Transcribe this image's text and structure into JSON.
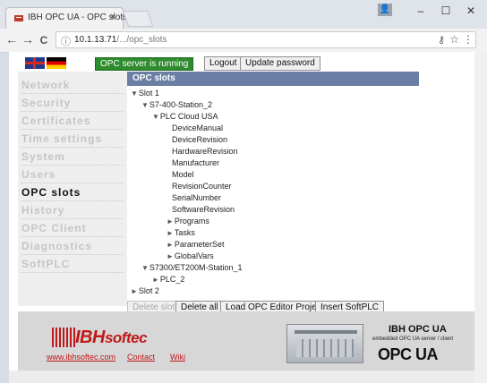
{
  "browser": {
    "tab_title": "IBH OPC UA - OPC slots",
    "tab_close": "×",
    "window_controls": {
      "minimize": "–",
      "maximize": "☐",
      "close": "✕"
    },
    "url_host": "10.1.13.71",
    "url_path": "/‌...‌/opc_slots",
    "nav": {
      "back": "←",
      "forward": "→",
      "reload": "C"
    }
  },
  "header": {
    "server_status": "OPC server is running",
    "logout_label": "Logout",
    "update_password_label": "Update password"
  },
  "sidebar": {
    "items": [
      {
        "label": "Network",
        "active": false
      },
      {
        "label": "Security",
        "active": false
      },
      {
        "label": "Certificates",
        "active": false
      },
      {
        "label": "Time settings",
        "active": false
      },
      {
        "label": "System",
        "active": false
      },
      {
        "label": "Users",
        "active": false
      },
      {
        "label": "OPC slots",
        "active": true
      },
      {
        "label": "History",
        "active": false
      },
      {
        "label": "OPC Client",
        "active": false
      },
      {
        "label": "Diagnostics",
        "active": false
      },
      {
        "label": "SoftPLC",
        "active": false
      }
    ]
  },
  "content": {
    "title": "OPC slots",
    "tree": [
      {
        "label": "Slot 1",
        "arrow": "▼",
        "level": 0
      },
      {
        "label": "S7-400-Station_2",
        "arrow": "▼",
        "level": 1
      },
      {
        "label": "PLC Cloud USA",
        "arrow": "▼",
        "level": 2
      },
      {
        "label": "DeviceManual",
        "arrow": "",
        "level": 3
      },
      {
        "label": "DeviceRevision",
        "arrow": "",
        "level": 3
      },
      {
        "label": "HardwareRevision",
        "arrow": "",
        "level": 3
      },
      {
        "label": "Manufacturer",
        "arrow": "",
        "level": 3
      },
      {
        "label": "Model",
        "arrow": "",
        "level": 3
      },
      {
        "label": "RevisionCounter",
        "arrow": "",
        "level": 3
      },
      {
        "label": "SerialNumber",
        "arrow": "",
        "level": 3
      },
      {
        "label": "SoftwareRevision",
        "arrow": "",
        "level": 3
      },
      {
        "label": "Programs",
        "arrow": "►",
        "level": 2.6
      },
      {
        "label": "Tasks",
        "arrow": "►",
        "level": 2.6
      },
      {
        "label": "ParameterSet",
        "arrow": "►",
        "level": 2.6
      },
      {
        "label": "GlobalVars",
        "arrow": "►",
        "level": 2.6
      },
      {
        "label": "S7300/ET200M-Station_1",
        "arrow": "▼",
        "level": 1
      },
      {
        "label": "PLC_2",
        "arrow": "►",
        "level": 2
      },
      {
        "label": "Slot 2",
        "arrow": "►",
        "level": 0
      }
    ],
    "buttons": {
      "delete_slot": "Delete slot",
      "delete_all": "Delete all",
      "load_project": "Load OPC Editor Project",
      "insert_softplc": "Insert SoftPLC"
    }
  },
  "footer": {
    "brand_left": "IBH",
    "brand_right": "softec",
    "links": {
      "website": "www.ibhsoftec.com",
      "contact": "Contact",
      "wiki": "Wiki"
    },
    "product_title": "IBH OPC UA",
    "product_subtitle": "embedded OPC UA server / client",
    "opc_logo": "OPC UA"
  },
  "colors": {
    "accent": "#6b7fa5",
    "status_green": "#2e8b2e",
    "brand_red": "#c01818"
  }
}
